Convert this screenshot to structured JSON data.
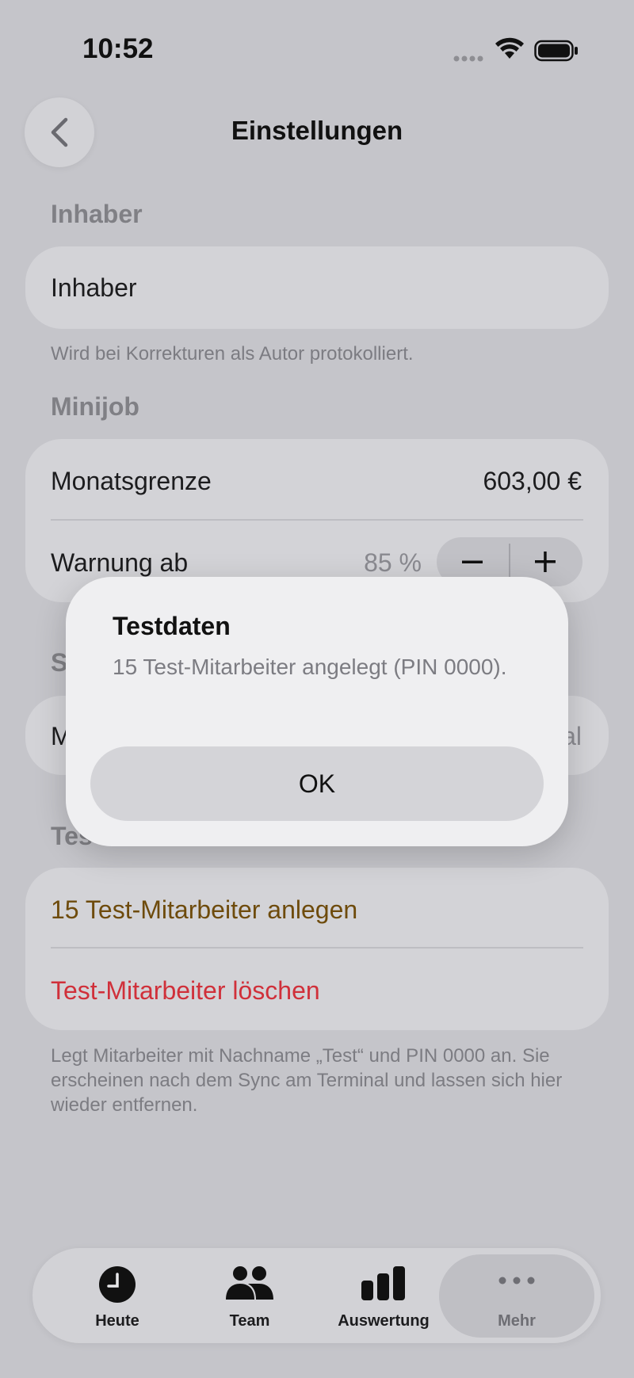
{
  "status_bar": {
    "time": "10:52"
  },
  "nav": {
    "title": "Einstellungen"
  },
  "sections": {
    "owner": {
      "header": "Inhaber",
      "field_value": "Inhaber",
      "footnote": "Wird bei Korrekturen als Autor protokolliert."
    },
    "minijob": {
      "header": "Minijob",
      "limit_label": "Monatsgrenze",
      "limit_value": "603,00 €",
      "warning_label": "Warnung ab",
      "warning_value": "85 %"
    },
    "partially_hidden": {
      "header_fragment": "S",
      "row_label_fragment": "M",
      "row_value_fragment": "al"
    },
    "test": {
      "header_fragment": "Tes",
      "create_label": "15 Test-Mitarbeiter anlegen",
      "delete_label": "Test-Mitarbeiter löschen",
      "footnote": "Legt Mitarbeiter mit Nachname „Test“ und PIN 0000 an. Sie erscheinen nach dem Sync am Terminal und lassen sich hier wieder entfernen."
    }
  },
  "alert": {
    "title": "Testdaten",
    "message": "15 Test-Mitarbeiter angelegt (PIN 0000).",
    "ok_label": "OK"
  },
  "tabbar": {
    "items": [
      {
        "label": "Heute",
        "icon": "clock-icon"
      },
      {
        "label": "Team",
        "icon": "people-icon"
      },
      {
        "label": "Auswertung",
        "icon": "chart-bars-icon"
      },
      {
        "label": "Mehr",
        "icon": "ellipsis-icon",
        "selected": true
      }
    ]
  },
  "colors": {
    "create_action": "#6e4b0c",
    "delete_action": "#d0303a",
    "background": "#c5c5ca"
  }
}
